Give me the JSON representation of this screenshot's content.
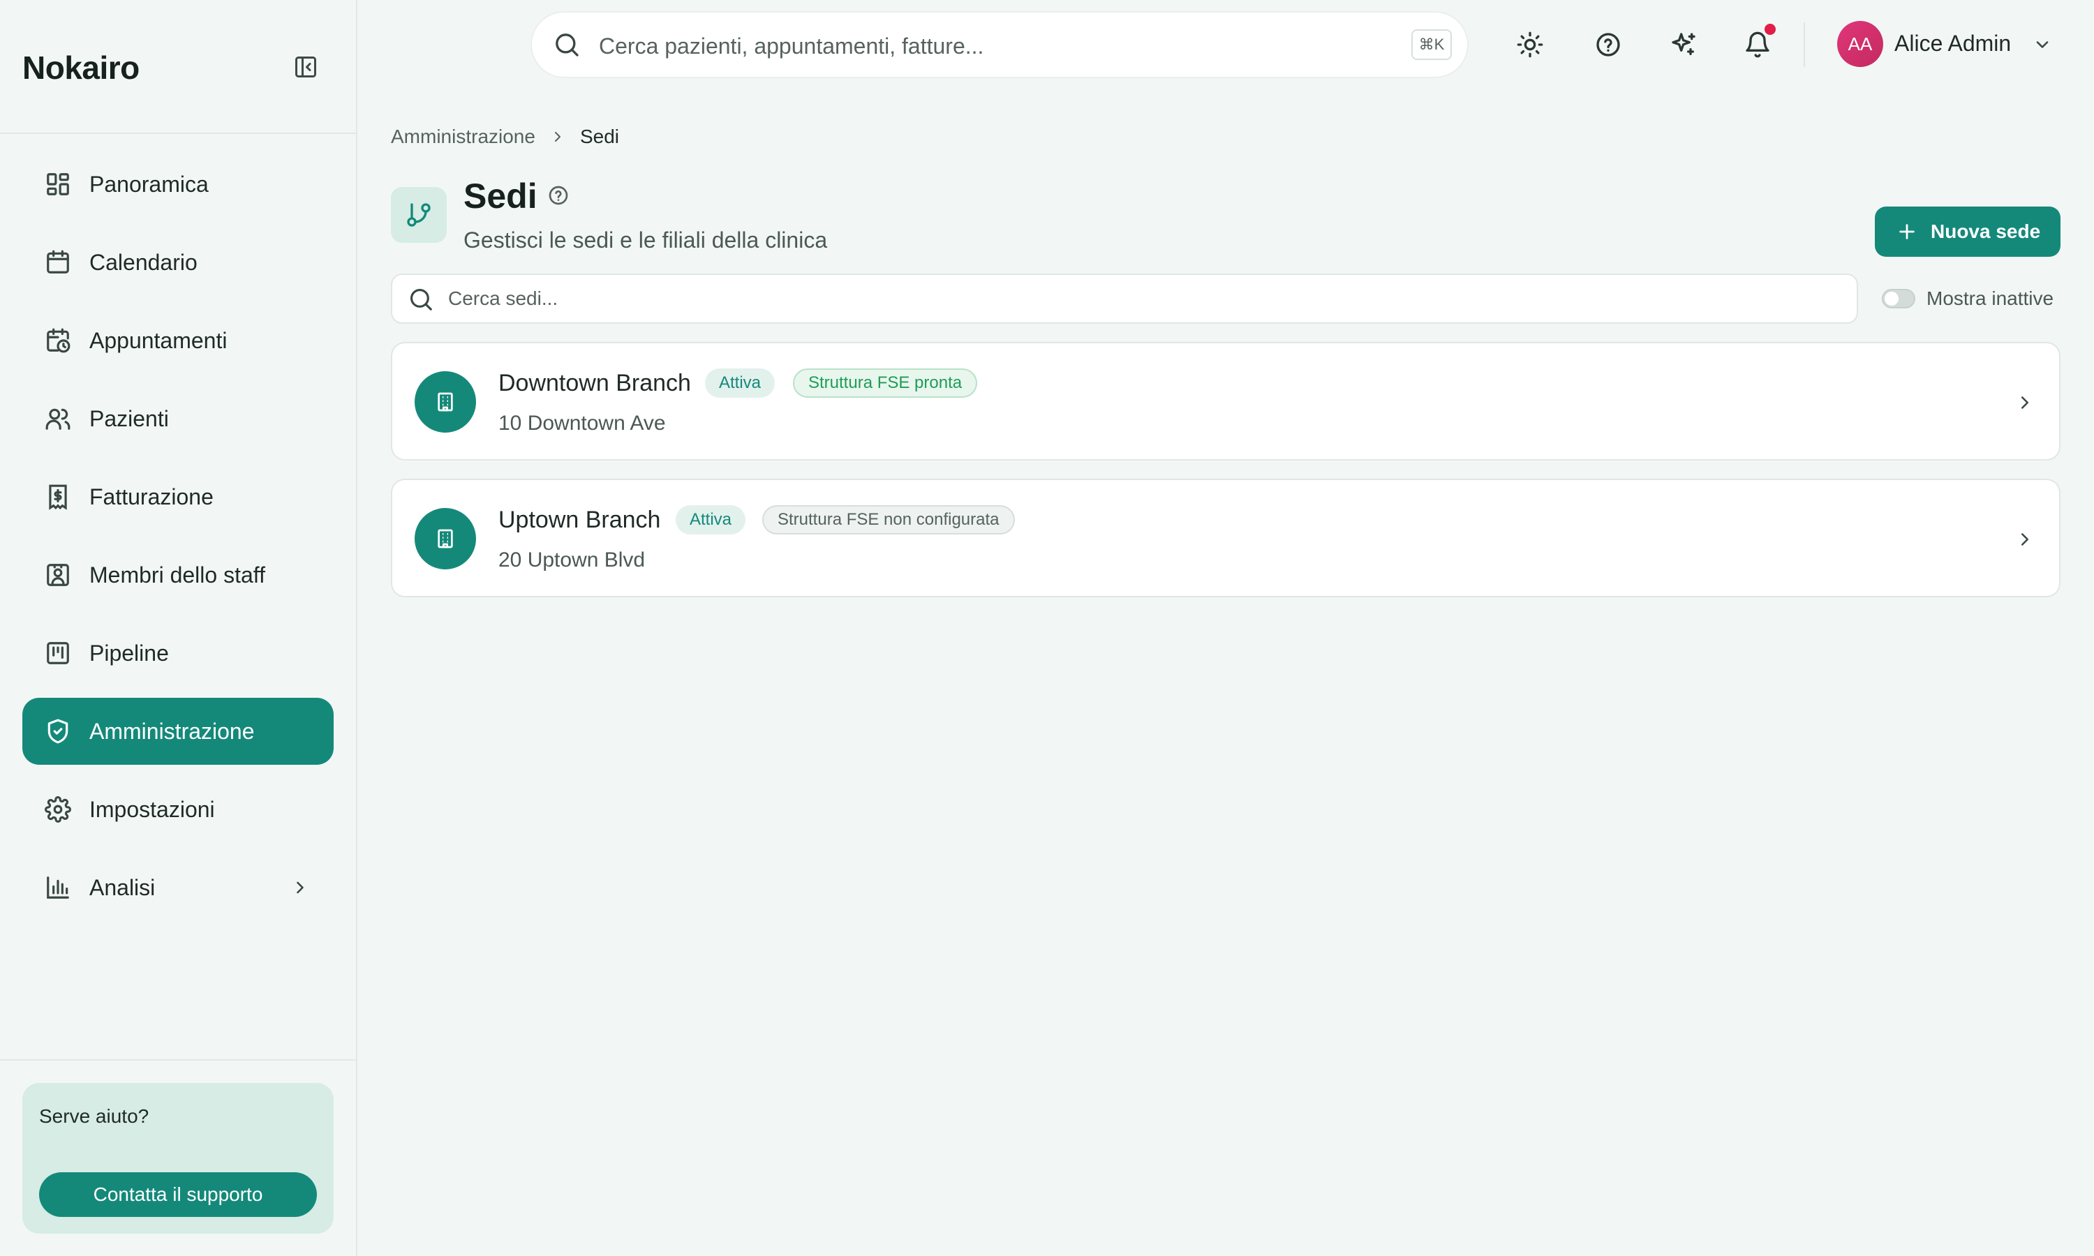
{
  "app": {
    "brand": "Nokairo"
  },
  "sidebar": {
    "items": [
      {
        "label": "Panoramica",
        "icon": "dashboard-icon"
      },
      {
        "label": "Calendario",
        "icon": "calendar-icon"
      },
      {
        "label": "Appuntamenti",
        "icon": "calendar-clock-icon"
      },
      {
        "label": "Pazienti",
        "icon": "users-icon"
      },
      {
        "label": "Fatturazione",
        "icon": "invoice-icon"
      },
      {
        "label": "Membri dello staff",
        "icon": "staff-badge-icon"
      },
      {
        "label": "Pipeline",
        "icon": "kanban-icon"
      },
      {
        "label": "Amministrazione",
        "icon": "shield-check-icon",
        "active": true
      },
      {
        "label": "Impostazioni",
        "icon": "gear-icon"
      },
      {
        "label": "Analisi",
        "icon": "bar-chart-icon",
        "has_submenu": true
      }
    ],
    "help": {
      "title": "Serve aiuto?",
      "button": "Contatta il supporto"
    }
  },
  "topbar": {
    "search_placeholder": "Cerca pazienti, appuntamenti, fatture...",
    "shortcut": "⌘K",
    "icons": [
      "sun-icon",
      "help-circle-icon",
      "sparkles-icon",
      "bell-icon"
    ],
    "user": {
      "initials": "AA",
      "name": "Alice Admin"
    }
  },
  "breadcrumb": {
    "parent": "Amministrazione",
    "current": "Sedi"
  },
  "page": {
    "title": "Sedi",
    "subtitle": "Gestisci le sedi e le filiali della clinica",
    "new_button": "Nuova sede",
    "search_placeholder": "Cerca sedi...",
    "toggle_label": "Mostra inattive"
  },
  "locations": [
    {
      "name": "Downtown Branch",
      "status": "Attiva",
      "fse": "Struttura FSE pronta",
      "address": "10 Downtown Ave"
    },
    {
      "name": "Uptown Branch",
      "status": "Attiva",
      "fse": "Struttura FSE non configurata",
      "address": "20 Uptown Blvd"
    }
  ],
  "colors": {
    "accent": "#14897a",
    "background": "#f2f7f5",
    "notification": "#e11d48",
    "fse_ready": "#1f9d55"
  }
}
